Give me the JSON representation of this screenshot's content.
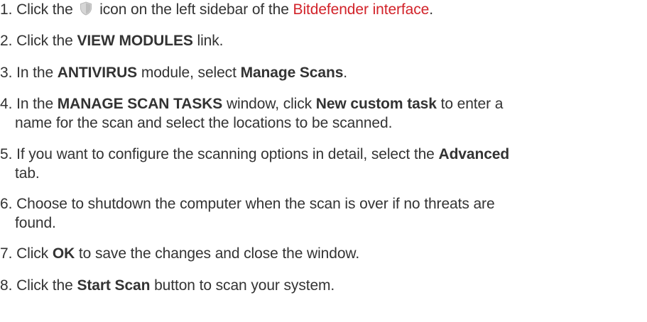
{
  "steps": [
    {
      "number": "1.",
      "before": "Click the",
      "icon": "shield-icon",
      "after": "icon on the left sidebar of the",
      "link": "Bitdefender interface",
      "end": "."
    },
    {
      "number": "2.",
      "before": "Click the",
      "bold": "VIEW MODULES",
      "after": "link."
    },
    {
      "number": "3.",
      "before": "In the",
      "bold1": "ANTIVIRUS",
      "middle": "module, select",
      "bold2": "Manage Scans",
      "end": "."
    },
    {
      "number": "4.",
      "before": "In the",
      "bold1": "MANAGE SCAN TASKS",
      "middle": "window, click",
      "bold2": "New custom task",
      "after_line1": "to enter a",
      "line2": "name for the scan and select the locations to be scanned."
    },
    {
      "number": "5.",
      "line1": "If you want to configure the scanning options in detail, select the",
      "bold": "Advanced",
      "line2": "tab."
    },
    {
      "number": "6.",
      "line1": "Choose to shutdown the computer when the scan is over if no threats are",
      "line2": "found."
    },
    {
      "number": "7.",
      "before": "Click",
      "bold": "OK",
      "after": "to save the changes and close the window."
    },
    {
      "number": "8.",
      "before": "Click the",
      "bold": "Start Scan",
      "after": "button to scan your system."
    }
  ],
  "colors": {
    "text": "#333333",
    "link": "#d2232a",
    "icon_fill": "#c8c8c8"
  }
}
